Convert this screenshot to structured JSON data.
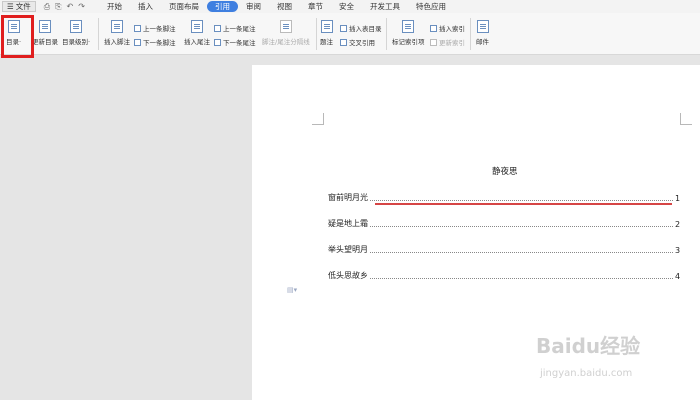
{
  "menubar": {
    "file_label": "文件",
    "quick_glyphs": [
      "⎙",
      "⎘",
      "↶",
      "↷"
    ],
    "tabs": [
      "开始",
      "插入",
      "页面布局",
      "引用",
      "审阅",
      "视图",
      "章节",
      "安全",
      "开发工具",
      "特色应用"
    ],
    "active_tab": "引用"
  },
  "ribbon": {
    "toc": "目录·",
    "refresh_toc": "更新目录",
    "toc_level": "目录级别·",
    "insert_footnote": "插入脚注",
    "prev_footnote": "上一条脚注",
    "next_footnote": "下一条脚注",
    "insert_endnote": "插入尾注",
    "prev_endnote": "上一条尾注",
    "next_endnote": "下一条尾注",
    "footnote_endnote_sep": "脚注/尾注分隔线",
    "caption": "题注",
    "insert_table_of_figures": "插入表目录",
    "cross_reference": "交叉引用",
    "mark_index_entry": "标记索引项",
    "insert_index": "插入索引",
    "update_index": "更新索引",
    "mail": "邮件"
  },
  "document": {
    "title": "静夜思",
    "toc_entries": [
      {
        "label": "窗前明月光",
        "page": "1"
      },
      {
        "label": "疑是地上霜",
        "page": "2"
      },
      {
        "label": "举头望明月",
        "page": "3"
      },
      {
        "label": "低头思故乡",
        "page": "4"
      }
    ]
  },
  "watermark": {
    "brand": "Baidu经验",
    "url": "jingyan.baidu.com"
  },
  "colors": {
    "accent": "#3f7fe0",
    "highlight_box": "#e01e1e",
    "underline": "#d64545"
  }
}
